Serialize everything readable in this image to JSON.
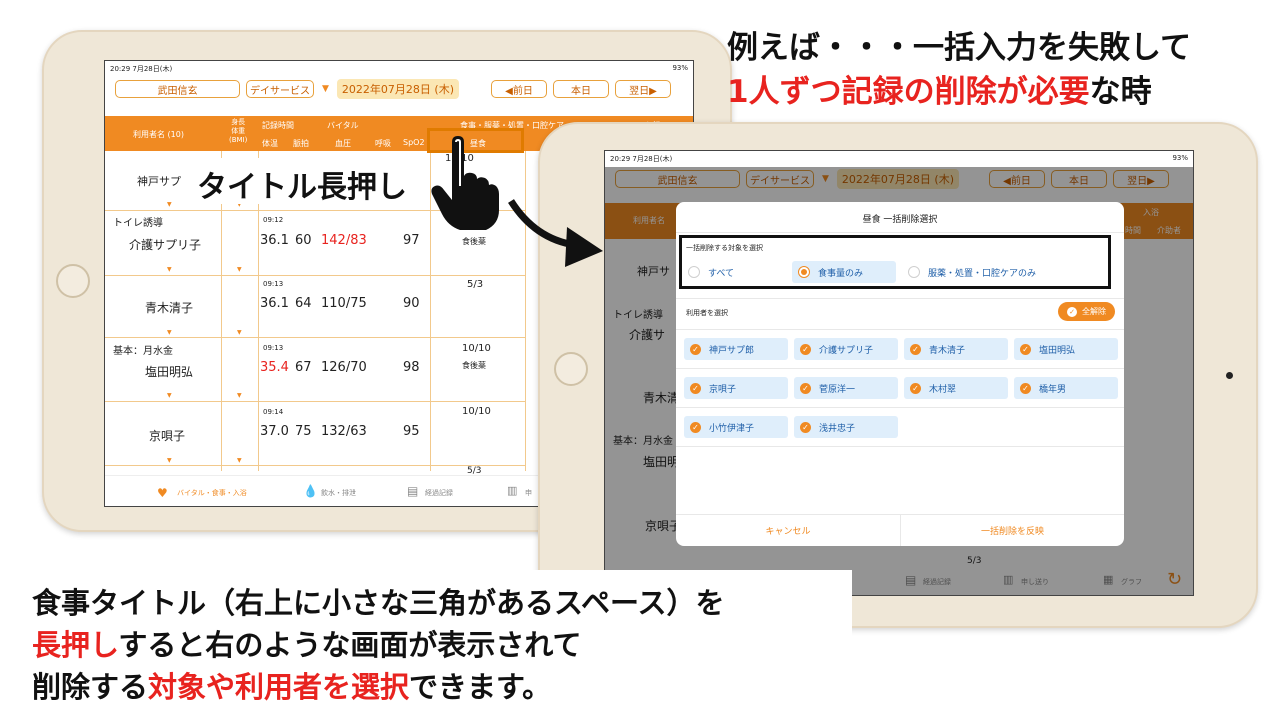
{
  "heading": {
    "line1": "例えば・・・一括入力を失敗して",
    "line2_red": "1人ずつ記録の削除が必要",
    "line2_black": "な時"
  },
  "bottom": {
    "l1": "食事タイトル（右上に小さな三角があるスペース）を",
    "l2_red": "長押し",
    "l2_black": "すると右のような画面が表示されて",
    "l3_a": "削除する",
    "l3_red": "対象や利用者を選択",
    "l3_b": "できます。"
  },
  "callout": "タイトル長押し",
  "left": {
    "status_time": "20:29  7月28日(木)",
    "status_right": "93%",
    "staff": "武田信玄",
    "service": "デイサービス",
    "date": "2022年07月28日 (木)",
    "prev": "◀前日",
    "today": "本日",
    "next": "翌日▶",
    "hdr": {
      "users": "利用者名 (10)",
      "height": "身長\n体重\n(BMI)",
      "time": "記録時間",
      "vital": "バイタル",
      "meals": "食事・服薬・処置・口腔ケア",
      "bath": "入浴",
      "temp": "体温",
      "pulse": "脈拍",
      "bp": "血圧",
      "resp": "呼吸",
      "spo2": "SpO2",
      "lunch": "昼食"
    },
    "rows": [
      {
        "note": "",
        "name": "神戸サプ",
        "time": "",
        "temp": "",
        "pulse": "",
        "bp": "",
        "spo2": "",
        "meal": "10/10",
        "med": ""
      },
      {
        "note": "トイレ誘導",
        "name": "介護サプリ子",
        "time": "09:12",
        "temp": "36.1",
        "pulse": "60",
        "bp": "142/83",
        "spo2": "97",
        "meal": "",
        "med": "食後薬"
      },
      {
        "note": "",
        "name": "青木清子",
        "time": "09:13",
        "temp": "36.1",
        "pulse": "64",
        "bp": "110/75",
        "spo2": "90",
        "meal": "5/3",
        "med": ""
      },
      {
        "note": "基本：月水金",
        "name": "塩田明弘",
        "time": "09:13",
        "temp": "35.4",
        "pulse": "67",
        "bp": "126/70",
        "spo2": "98",
        "meal": "10/10",
        "med": "食後薬"
      },
      {
        "note": "",
        "name": "京唄子",
        "time": "09:14",
        "temp": "37.0",
        "pulse": "75",
        "bp": "132/63",
        "spo2": "95",
        "meal": "10/10",
        "med": ""
      }
    ],
    "last_meal": "5/3",
    "tabs": [
      "バイタル・食事・入浴",
      "飲水・排泄",
      "経過記録",
      "申"
    ]
  },
  "right": {
    "status_time": "20:29  7月28日(木)",
    "status_right": "93%",
    "staff": "武田信玄",
    "service": "デイサービス",
    "date": "2022年07月28日 (木)",
    "prev": "◀前日",
    "today": "本日",
    "next": "翌日▶",
    "bg_users": "利用者名",
    "bath": "入浴",
    "bath_time": "時間",
    "bath_staff": "介助者",
    "bg_rows": [
      {
        "note": "",
        "name": "神戸サ"
      },
      {
        "note": "トイレ誘導",
        "name": "介護サ"
      },
      {
        "note": "",
        "name": "青木清"
      },
      {
        "note": "基本：月水金",
        "name": "塩田明"
      },
      {
        "note": "",
        "name": "京唄子"
      }
    ],
    "bg_meal": "5/3",
    "tabs": [
      "経過記録",
      "申し送り",
      "グラフ"
    ],
    "modal": {
      "title": "昼食 一括削除選択",
      "target_label": "一括削除する対象を選択",
      "options": [
        "すべて",
        "食事量のみ",
        "服薬・処置・口腔ケアのみ"
      ],
      "selected": 1,
      "users_label": "利用者を選択",
      "clear_all": "全解除",
      "users": [
        "神戸サプ郎",
        "介護サプリ子",
        "青木清子",
        "塩田明弘",
        "京唄子",
        "菅原洋一",
        "木村翠",
        "橋年男",
        "小竹伊津子",
        "浅井忠子"
      ],
      "cancel": "キャンセル",
      "apply": "一括削除を反映"
    }
  },
  "colors": {
    "orange": "#f08a22",
    "red": "#e8231f",
    "highlight_box": "#e07b00"
  }
}
